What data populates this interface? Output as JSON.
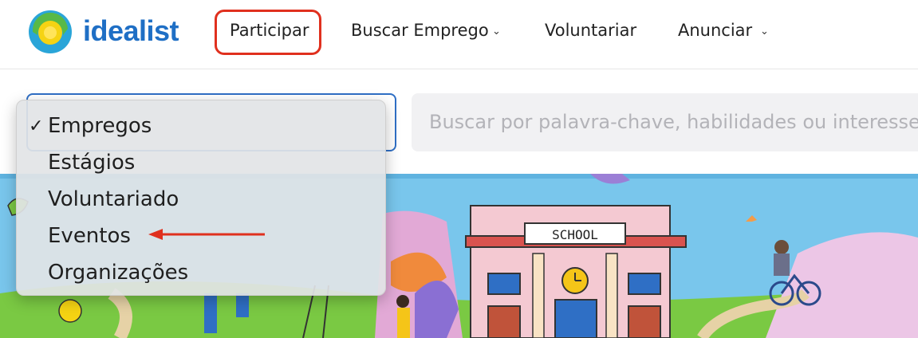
{
  "brand": {
    "name": "idealist"
  },
  "nav": {
    "participar": "Participar",
    "buscar_emprego": "Buscar Emprego",
    "voluntariar": "Voluntariar",
    "anunciar": "Anunciar"
  },
  "search": {
    "placeholder": "Buscar por palavra-chave, habilidades ou interesse"
  },
  "dropdown": {
    "check_mark": "✓",
    "options": [
      "Empregos",
      "Estágios",
      "Voluntariado",
      "Eventos",
      "Organizações"
    ],
    "selected_index": 0
  },
  "illustration": {
    "sign_text": "SCHOOL"
  },
  "colors": {
    "accent": "#1f6fc5",
    "highlight": "#e0301e",
    "sky": "#79c6ec",
    "grass": "#7ac943"
  }
}
